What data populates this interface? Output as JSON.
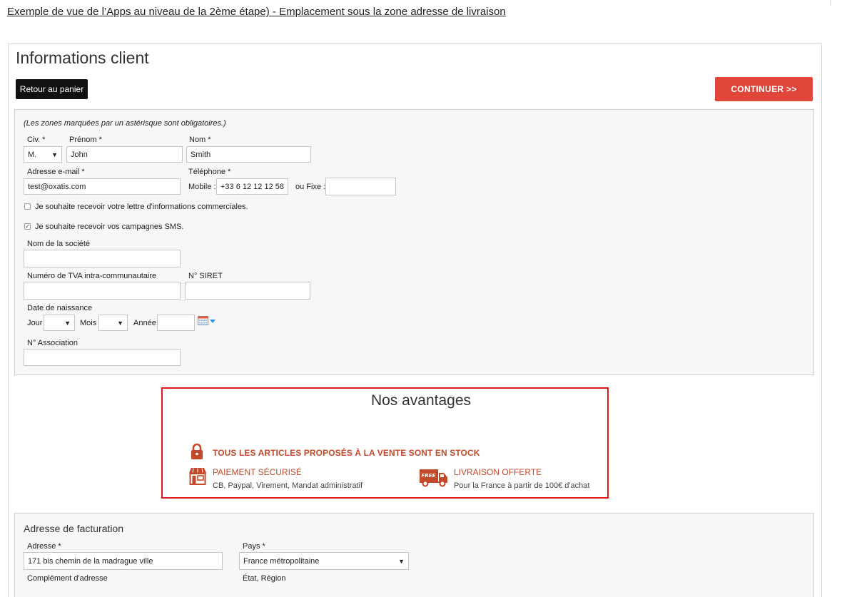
{
  "header": {
    "caption": "Exemple de vue de l’Apps au niveau de la 2ème étape) - Emplacement sous la zone adresse de livraison"
  },
  "page": {
    "title": "Informations client",
    "back_label": "Retour au panier",
    "continue_label": "CONTINUER >>"
  },
  "form": {
    "required_note": "(Les zones marquées par un astérisque sont obligatoires.)",
    "civ_label": "Civ. *",
    "civ_value": "M.",
    "prenom_label": "Prénom *",
    "prenom_value": "John",
    "nom_label": "Nom *",
    "nom_value": "Smith",
    "email_label": "Adresse e-mail *",
    "email_value": "test@oxatis.com",
    "phone_label": "Téléphone *",
    "mobile_label": "Mobile :",
    "mobile_value": "+33 6 12 12 12 58",
    "fixe_label": "ou Fixe :",
    "fixe_value": "",
    "newsletter_label": "Je souhaite recevoir votre lettre d'informations commerciales.",
    "newsletter_checked": false,
    "sms_label": "Je souhaite recevoir vos campagnes SMS.",
    "sms_checked": true,
    "company_label": "Nom de la société",
    "tva_label": "Numéro de TVA intra-communautaire",
    "siret_label": "N° SIRET",
    "birth_label": "Date de naissance",
    "jour_label": "Jour",
    "mois_label": "Mois",
    "annee_label": "Année",
    "association_label": "N° Association"
  },
  "advantages": {
    "title": "Nos avantages",
    "main": "TOUS LES ARTICLES PROPOSÉS À LA VENTE SONT EN STOCK",
    "payment_title": "PAIEMENT SÉCURISÉ",
    "payment_sub": "CB, Paypal, Virement, Mandat administratif",
    "delivery_title": "LIVRAISON OFFERTE",
    "delivery_sub": "Pour la France à partir de 100€ d'achat",
    "free_badge": "FREE",
    "accent_color": "#c4492a",
    "border_color": "#e01a1a"
  },
  "billing": {
    "title": "Adresse de facturation",
    "address_label": "Adresse *",
    "address_value": "171 bis chemin de la madrague ville",
    "country_label": "Pays *",
    "country_value": "France métropolitaine",
    "complement_label": "Complément d'adresse",
    "region_label": "État, Région"
  },
  "colors": {
    "continue": "#e2463a",
    "back": "#111111"
  },
  "icons": [
    "lock-icon",
    "shop-icon",
    "delivery-truck-icon",
    "calendar-icon"
  ]
}
